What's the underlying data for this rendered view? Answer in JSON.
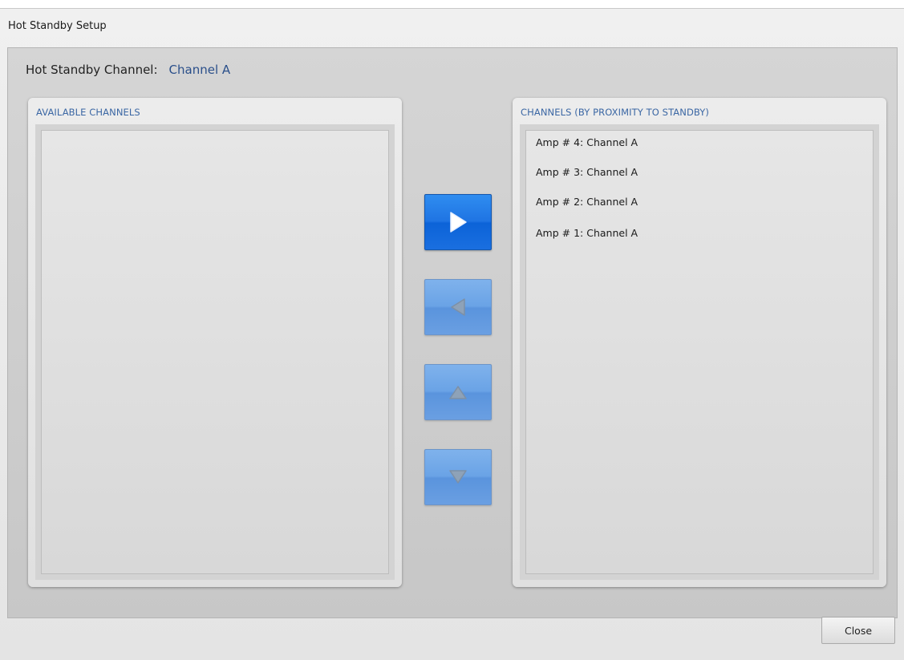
{
  "window": {
    "title": "Hot Standby Setup"
  },
  "standby": {
    "label": "Hot Standby Channel:",
    "value": "Channel A"
  },
  "available_panel": {
    "header": "AVAILABLE CHANNELS",
    "items": []
  },
  "proximity_panel": {
    "header": "CHANNELS (BY PROXIMITY TO STANDBY)",
    "items": [
      "Amp # 4: Channel A",
      "Amp # 3: Channel A",
      "Amp # 2: Channel A",
      "Amp # 1: Channel A"
    ]
  },
  "arrows": {
    "move_right": {
      "icon": "play-right-icon",
      "enabled": true
    },
    "move_left": {
      "icon": "play-left-icon",
      "enabled": false
    },
    "move_up": {
      "icon": "triangle-up-icon",
      "enabled": false
    },
    "move_down": {
      "icon": "triangle-down-icon",
      "enabled": false
    }
  },
  "footer": {
    "close_label": "Close"
  },
  "colors": {
    "accent": "#1f74e3",
    "header_text": "#3b67a4",
    "standby_value": "#2a4f8a"
  }
}
